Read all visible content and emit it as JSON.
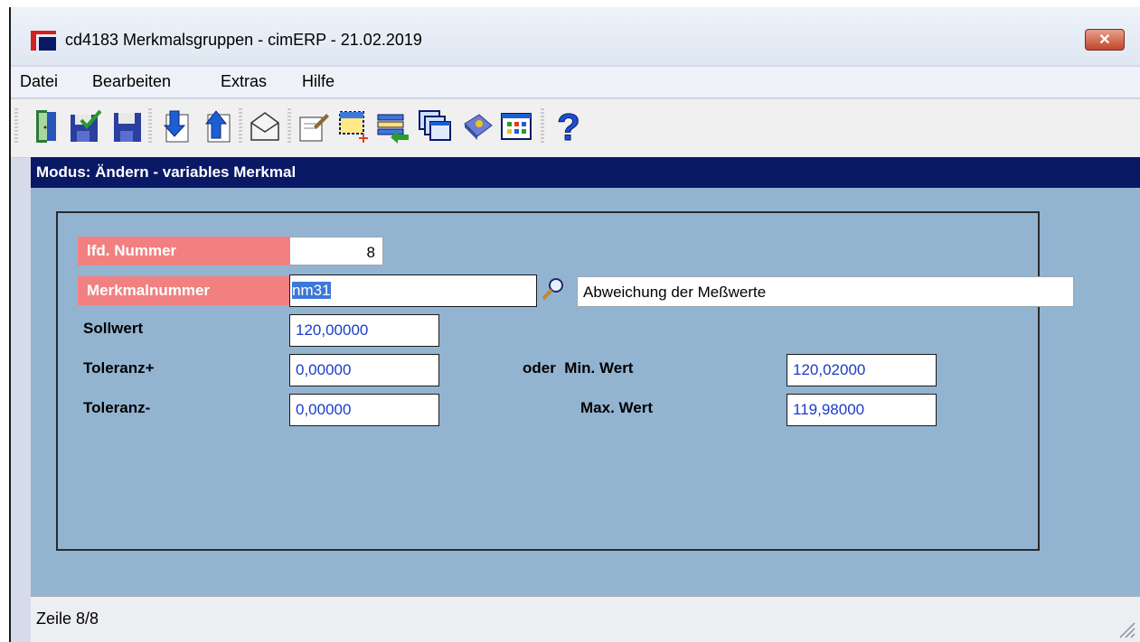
{
  "window": {
    "title": "cd4183 Merkmalsgruppen - cimERP - 21.02.2019",
    "close_label": "✕"
  },
  "menu": {
    "items": [
      "Datei",
      "Bearbeiten",
      "Extras",
      "Hilfe"
    ]
  },
  "toolbar": {
    "icons": [
      "exit-door-icon",
      "save-check-icon",
      "save-icon",
      "arrow-down-page-icon",
      "arrow-up-page-icon",
      "envelope-icon",
      "edit-document-icon",
      "new-record-icon",
      "list-import-icon",
      "windows-cascade-icon",
      "book-icon",
      "table-grid-icon",
      "help-icon"
    ]
  },
  "mode": {
    "text": "Modus: Ändern - variables Merkmal"
  },
  "form": {
    "lfd_label": "lfd. Nummer",
    "lfd_value": "8",
    "merkmal_label": "Merkmalnummer",
    "merkmal_value": "nm31",
    "merkmal_description": "Abweichung der Meßwerte",
    "sollwert_label": "Sollwert",
    "sollwert_value": "120,00000",
    "tol_plus_label": "Toleranz+",
    "tol_plus_value": "0,00000",
    "tol_minus_label": "Toleranz-",
    "tol_minus_value": "0,00000",
    "min_label": "oder  Min. Wert",
    "min_value": "120,02000",
    "max_label": "Max. Wert",
    "max_value": "119,98000"
  },
  "status": {
    "text": "Zeile 8/8"
  },
  "colors": {
    "mode_bar": "#0a1966",
    "content_bg": "#93b4d1",
    "required_label": "#f28080",
    "field_text": "#1a3cc8"
  }
}
